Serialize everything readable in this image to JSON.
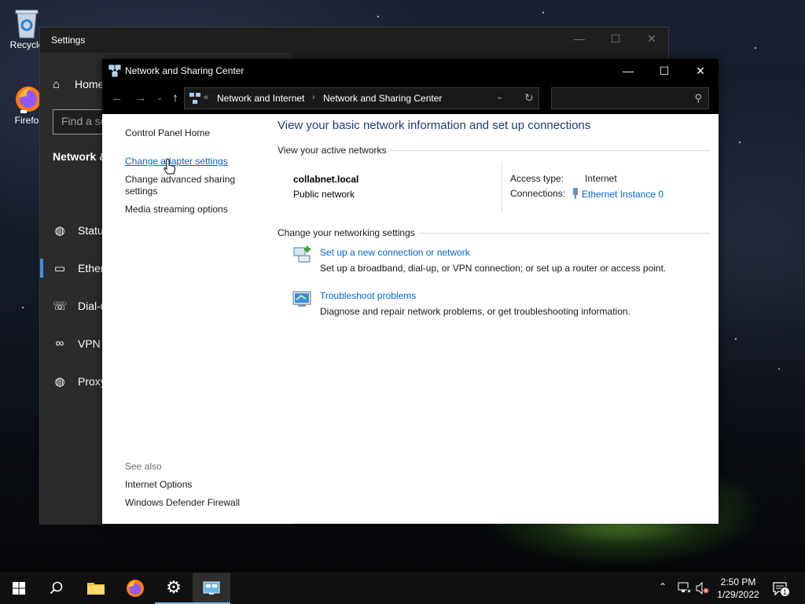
{
  "desktop": {
    "icons": [
      {
        "label": "Recycle",
        "icon": "recycle-bin-icon"
      },
      {
        "label": "Firefo",
        "icon": "firefox-icon"
      }
    ]
  },
  "settings_window": {
    "title": "Settings",
    "home_label": "Home",
    "search_placeholder": "Find a se",
    "heading": "Network &",
    "nav_items": [
      {
        "label": "Status",
        "icon": "globe-icon"
      },
      {
        "label": "Ether",
        "icon": "ethernet-icon",
        "active": true
      },
      {
        "label": "Dial-u",
        "icon": "dialup-icon"
      },
      {
        "label": "VPN",
        "icon": "vpn-icon"
      },
      {
        "label": "Proxy",
        "icon": "globe-icon"
      }
    ]
  },
  "nsc_window": {
    "title": "Network and Sharing Center",
    "address": {
      "overflow": "«",
      "crumbs": [
        "Network and Internet",
        "Network and Sharing Center"
      ]
    },
    "search_placeholder": "",
    "left_links": [
      "Control Panel Home",
      "Change adapter settings",
      "Change advanced sharing settings",
      "Media streaming options"
    ],
    "see_also": {
      "label": "See also",
      "links": [
        "Internet Options",
        "Windows Defender Firewall"
      ]
    },
    "main_title": "View your basic network information and set up connections",
    "active_networks": {
      "title": "View your active networks",
      "network_name": "collabnet.local",
      "network_category": "Public network",
      "access_type_label": "Access type:",
      "access_type_value": "Internet",
      "connections_label": "Connections:",
      "connections_value": "Ethernet Instance 0"
    },
    "change_settings": {
      "title": "Change your networking settings",
      "tasks": [
        {
          "link": "Set up a new connection or network",
          "desc": "Set up a broadband, dial-up, or VPN connection; or set up a router or access point."
        },
        {
          "link": "Troubleshoot problems",
          "desc": "Diagnose and repair network problems, or get troubleshooting information."
        }
      ]
    }
  },
  "taskbar": {
    "time": "2:50 PM",
    "date": "1/29/2022",
    "notification_count": "1"
  },
  "colors": {
    "link": "#0066cc",
    "title_blue": "#1e3c78",
    "accent": "#76b9ed"
  }
}
